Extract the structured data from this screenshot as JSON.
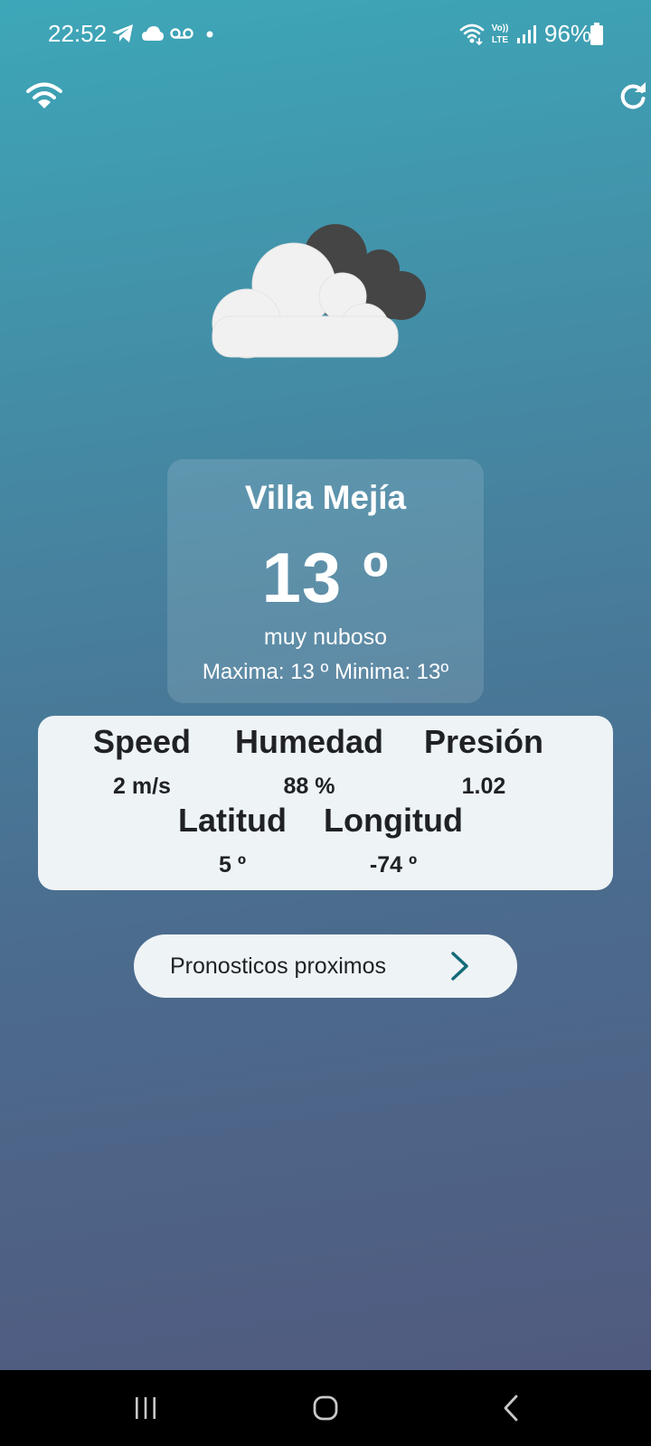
{
  "status_bar": {
    "time": "22:52",
    "battery_percent": "96%",
    "icons": [
      "telegram-icon",
      "cloud-icon",
      "voicemail-icon",
      "dot-icon",
      "wifi-calling-icon",
      "volte-icon",
      "signal-icon",
      "battery-icon"
    ]
  },
  "top_bar": {
    "left_icon": "wifi-icon",
    "right_icon": "refresh-icon"
  },
  "weather": {
    "icon": "cloudy-icon",
    "city": "Villa Mejía",
    "temperature": "13 º",
    "description": "muy nuboso",
    "min_max": "Maxima: 13 º Minima: 13º"
  },
  "details": {
    "speed_label": "Speed",
    "speed_value": "2 m/s",
    "humidity_label": "Humedad",
    "humidity_value": "88 %",
    "pressure_label": "Presión",
    "pressure_value": "1.02",
    "latitude_label": "Latitud",
    "latitude_value": "5 º",
    "longitude_label": "Longitud",
    "longitude_value": "-74 º"
  },
  "forecast_button": {
    "label": "Pronosticos proximos",
    "icon": "chevron-right-icon"
  },
  "colors": {
    "gradient_top": "#3da7b8",
    "gradient_bottom": "#51577c",
    "card": "#eef3f6",
    "accent": "#136b78"
  },
  "nav_bar": {
    "icons": [
      "recent-apps-icon",
      "home-icon",
      "back-icon"
    ]
  }
}
